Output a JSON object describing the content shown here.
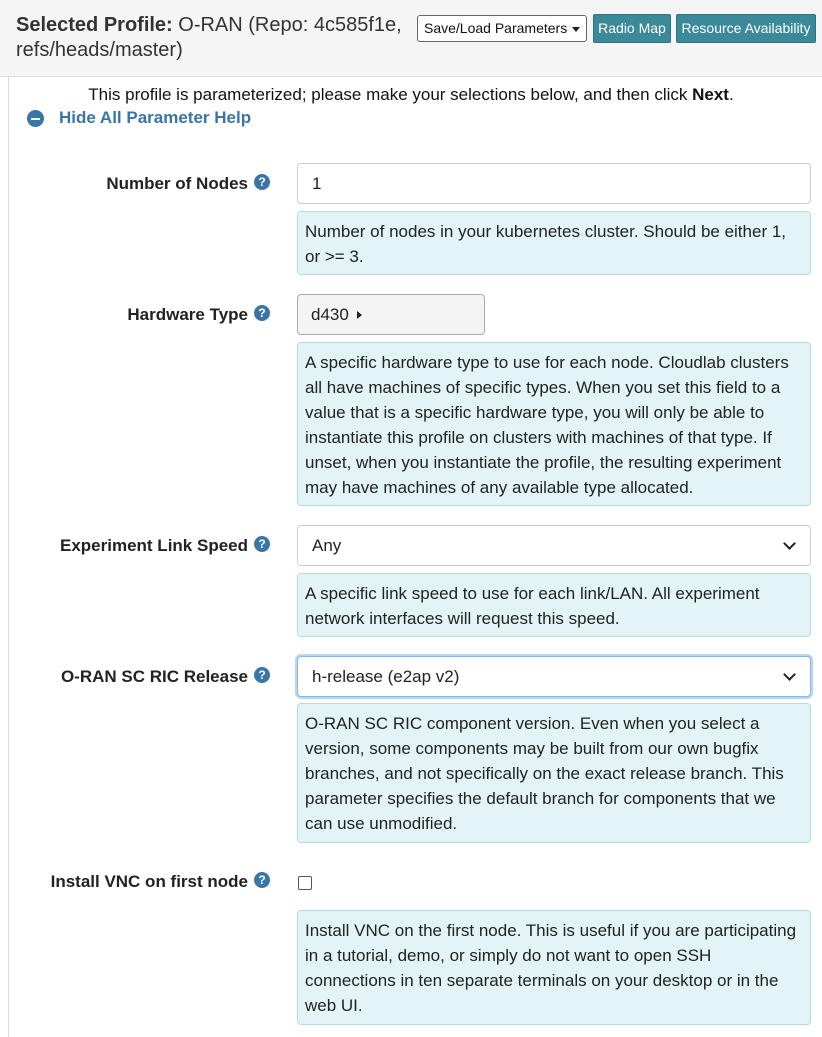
{
  "header": {
    "title_bold": "Selected Profile:",
    "title_rest": " O-RAN (Repo: 4c585f1e, refs/heads/master)",
    "save_load_label": "Save/Load Parameters",
    "radio_map_label": "Radio Map",
    "resource_availability_label": "Resource Availability"
  },
  "intro": {
    "text": "This profile is parameterized; please make your selections below, and then click ",
    "emphasis": "Next",
    "end": "."
  },
  "help_toggle": {
    "label": "Hide All Parameter Help"
  },
  "params": {
    "nodes": {
      "label": "Number of Nodes",
      "value": "1",
      "help": "Number of nodes in your kubernetes cluster. Should be either 1, or >= 3."
    },
    "hardware": {
      "label": "Hardware Type",
      "value": "d430",
      "help": "A specific hardware type to use for each node. Cloudlab clusters all have machines of specific types. When you set this field to a value that is a specific hardware type, you will only be able to instantiate this profile on clusters with machines of that type. If unset, when you instantiate the profile, the resulting experiment may have machines of any available type allocated."
    },
    "link_speed": {
      "label": "Experiment Link Speed",
      "value": "Any",
      "help": "A specific link speed to use for each link/LAN. All experiment network interfaces will request this speed."
    },
    "ric_release": {
      "label": "O-RAN SC RIC Release",
      "value": "h-release (e2ap v2)",
      "help": "O-RAN SC RIC component version. Even when you select a version, some components may be built from our own bugfix branches, and not specifically on the exact release branch. This parameter specifies the default branch for components that we can use unmodified."
    },
    "vnc": {
      "label": "Install VNC on first node",
      "checked": false,
      "help": "Install VNC on the first node. This is useful if you are participating in a tutorial, demo, or simply do not want to open SSH connections in ten separate terminals on your desktop or in the web UI."
    }
  },
  "icons": {
    "help_glyph": "?",
    "accent": "#3a75a8",
    "help_bg": "#e3f4f7",
    "button_bg": "#3a8a9a"
  }
}
